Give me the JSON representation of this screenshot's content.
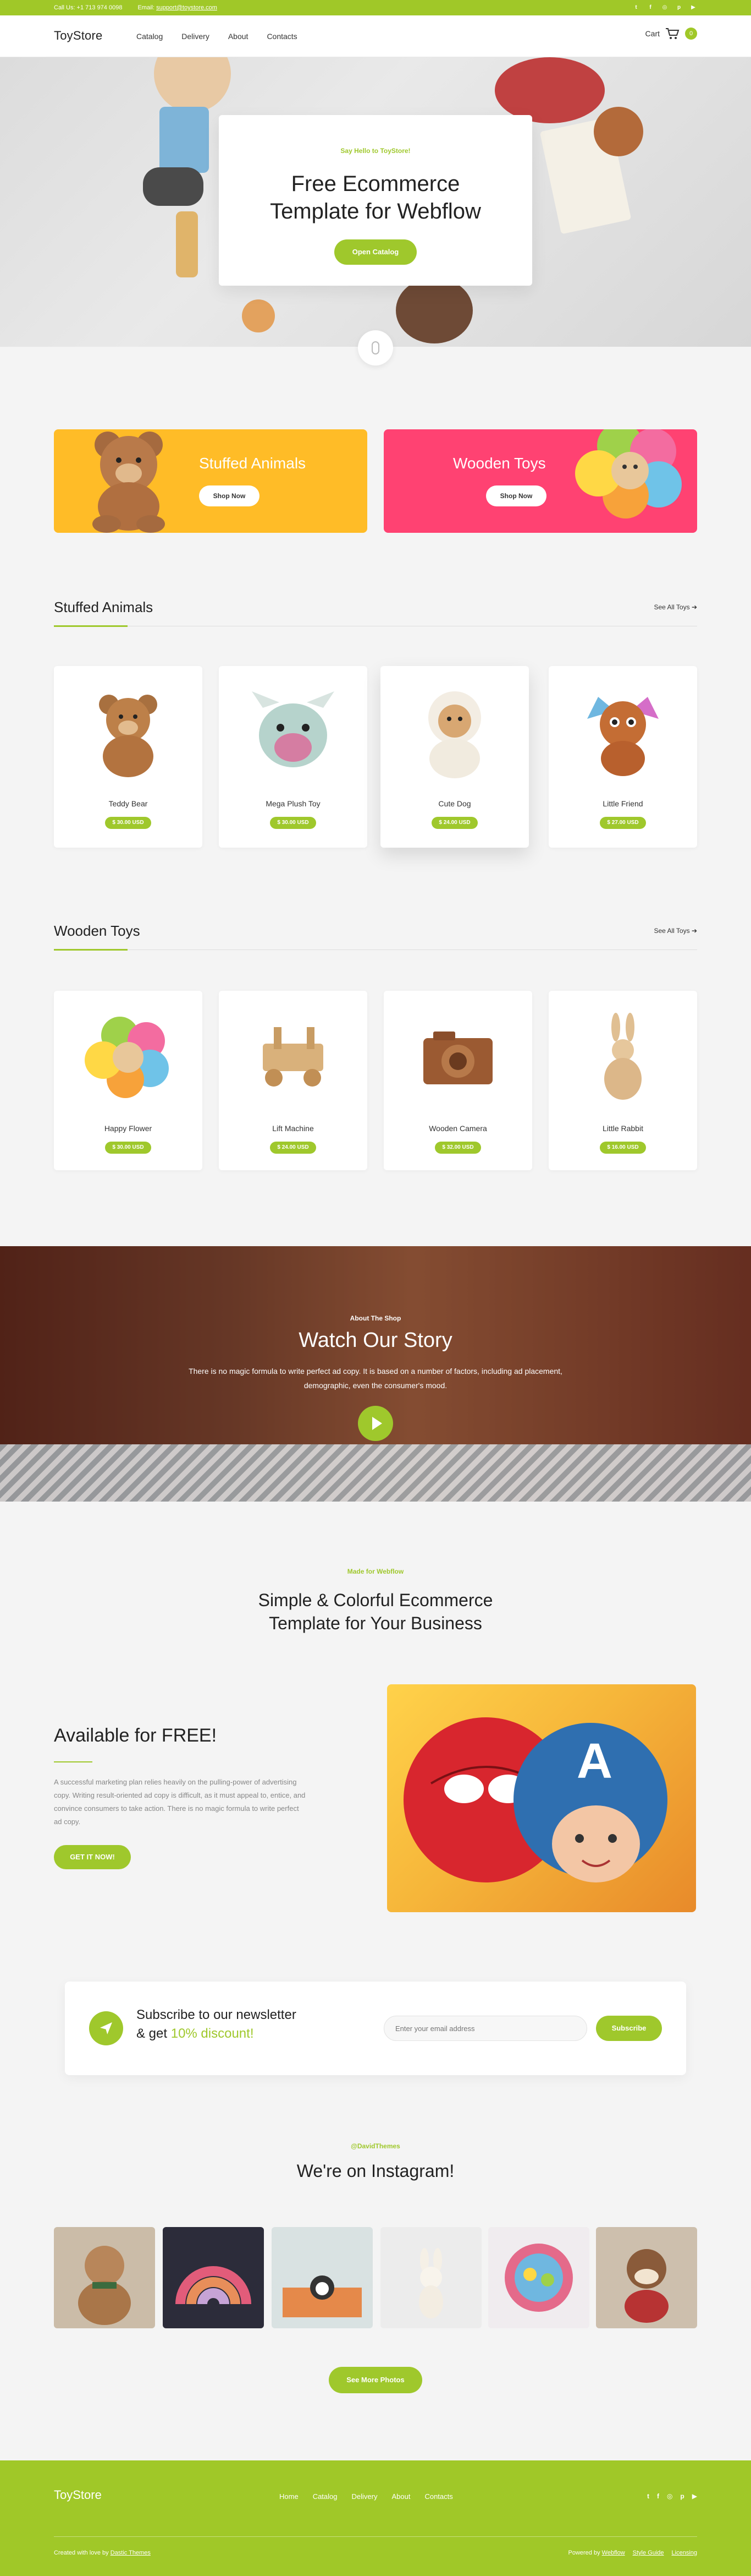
{
  "topbar": {
    "phone": "Call Us: +1 713 974 0098",
    "email_label": "Email:",
    "email": "support@toystore.com",
    "socials": [
      "twitter-icon",
      "facebook-icon",
      "instagram-icon",
      "pinterest-icon",
      "youtube-icon"
    ]
  },
  "navbar": {
    "logo": "ToyStore",
    "links": [
      "Catalog",
      "Delivery",
      "About",
      "Contacts"
    ],
    "cart_label": "Cart",
    "cart_count": "0"
  },
  "hero": {
    "eyebrow": "Say Hello to ToyStore!",
    "title": "Free Ecommerce Template for Webflow",
    "button": "Open Catalog"
  },
  "banners": [
    {
      "title": "Stuffed Animals",
      "button": "Shop Now"
    },
    {
      "title": "Wooden Toys",
      "button": "Shop Now"
    }
  ],
  "stuffed": {
    "title": "Stuffed Animals",
    "see_all": "See All Toys",
    "items": [
      {
        "name": "Teddy Bear",
        "price": "$ 30.00 USD"
      },
      {
        "name": "Mega Plush Toy",
        "price": "$ 30.00 USD"
      },
      {
        "name": "Cute Dog",
        "price": "$ 24.00 USD"
      },
      {
        "name": "Little Friend",
        "price": "$ 27.00 USD"
      }
    ]
  },
  "wooden": {
    "title": "Wooden Toys",
    "see_all": "See All Toys",
    "items": [
      {
        "name": "Happy Flower",
        "price": "$ 30.00 USD"
      },
      {
        "name": "Lift Machine",
        "price": "$ 24.00 USD"
      },
      {
        "name": "Wooden Camera",
        "price": "$ 32.00 USD"
      },
      {
        "name": "Little Rabbit",
        "price": "$ 16.00 USD"
      }
    ]
  },
  "story": {
    "eyebrow": "About The Shop",
    "title": "Watch Our Story",
    "text": "There is no magic formula to write perfect ad copy. It is based on a number of factors, including ad placement, demographic, even the consumer's mood."
  },
  "made": {
    "eyebrow": "Made for Webflow",
    "title": "Simple & Colorful Ecommerce Template for Your Business"
  },
  "free": {
    "title": "Available for FREE!",
    "text": "A successful marketing plan relies heavily on the pulling-power of advertising copy. Writing result-oriented ad copy is difficult, as it must appeal to, entice, and convince consumers to take action. There is no magic formula to write perfect ad copy.",
    "button": "GET IT NOW!"
  },
  "newsletter": {
    "line1": "Subscribe to our newsletter",
    "line2_prefix": "& get",
    "line2_highlight": "10% discount!",
    "placeholder": "Enter your email address",
    "button": "Subscribe"
  },
  "instagram": {
    "eyebrow": "@DavidThemes",
    "title": "We're on Instagram!",
    "button": "See More Photos"
  },
  "footer": {
    "logo": "ToyStore",
    "links": [
      "Home",
      "Catalog",
      "Delivery",
      "About",
      "Contacts"
    ],
    "credit_prefix": "Created with love by",
    "credit_link": "Dastic Themes",
    "powered_prefix": "Powered by",
    "powered_link": "Webflow",
    "style_guide": "Style Guide",
    "licensing": "Licensing"
  },
  "colors": {
    "accent": "#a0c828",
    "yellow_banner": "#ffbc27",
    "pink_banner": "#ff4272"
  }
}
